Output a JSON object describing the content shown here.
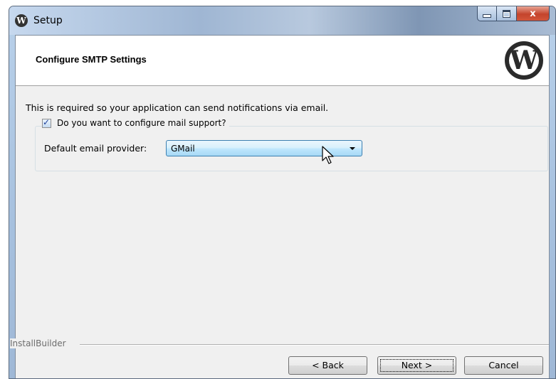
{
  "window": {
    "title": "Setup",
    "app_icon_glyph": "W",
    "minimize_label": "",
    "maximize_label": "",
    "close_label": "x"
  },
  "header": {
    "title": "Configure SMTP Settings",
    "logo_icon": "wordpress-logo-icon",
    "logo_glyph": "W"
  },
  "body": {
    "description": "This is required so your application can send notifications via email.",
    "mail_support": {
      "label": "Do you want to configure mail support?",
      "checked": true
    },
    "provider": {
      "label": "Default email provider:",
      "value": "GMail"
    }
  },
  "footer": {
    "brand": "InstallBuilder",
    "back_label": "< Back",
    "next_label": "Next >",
    "cancel_label": "Cancel"
  },
  "colors": {
    "combo_border": "#3c7fb1",
    "close_button": "#c4442c"
  }
}
